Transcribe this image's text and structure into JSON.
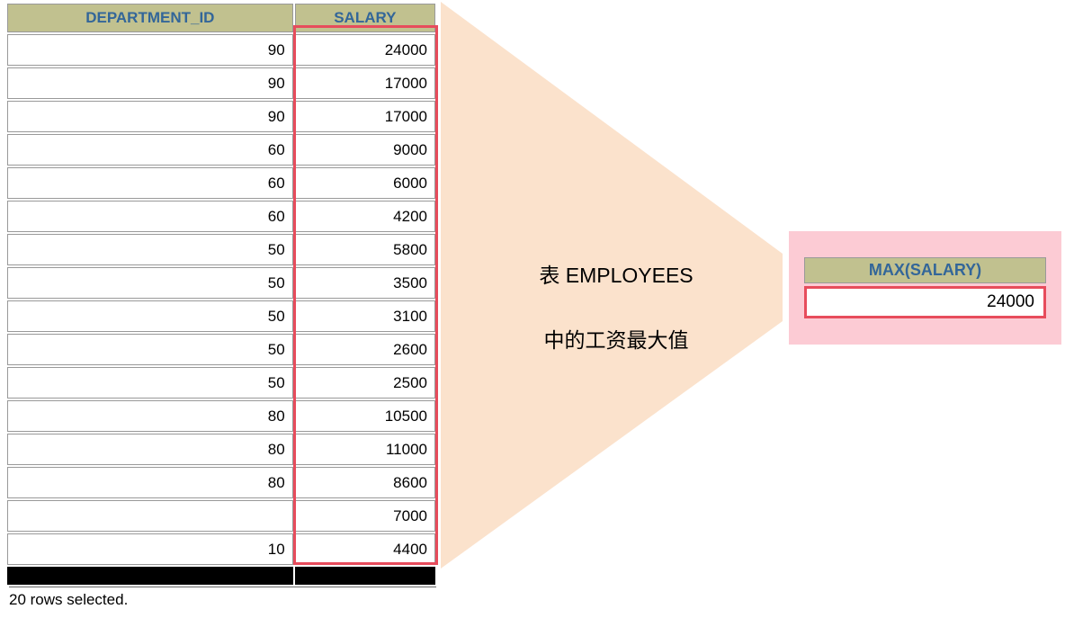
{
  "source_table": {
    "columns": [
      "DEPARTMENT_ID",
      "SALARY"
    ],
    "rows": [
      {
        "dept": "90",
        "salary": "24000"
      },
      {
        "dept": "90",
        "salary": "17000"
      },
      {
        "dept": "90",
        "salary": "17000"
      },
      {
        "dept": "60",
        "salary": "9000"
      },
      {
        "dept": "60",
        "salary": "6000"
      },
      {
        "dept": "60",
        "salary": "4200"
      },
      {
        "dept": "50",
        "salary": "5800"
      },
      {
        "dept": "50",
        "salary": "3500"
      },
      {
        "dept": "50",
        "salary": "3100"
      },
      {
        "dept": "50",
        "salary": "2600"
      },
      {
        "dept": "50",
        "salary": "2500"
      },
      {
        "dept": "80",
        "salary": "10500"
      },
      {
        "dept": "80",
        "salary": "11000"
      },
      {
        "dept": "80",
        "salary": "8600"
      },
      {
        "dept": "",
        "salary": "7000"
      },
      {
        "dept": "10",
        "salary": "4400"
      }
    ]
  },
  "footer": "20 rows selected.",
  "annotation": {
    "line1": "表 EMPLOYEES",
    "line2": "中的工资最大值"
  },
  "result_table": {
    "header": "MAX(SALARY)",
    "value": "24000"
  },
  "chart_data": {
    "type": "table",
    "title": "MAX aggregate over EMPLOYEES.SALARY",
    "source_columns": [
      "DEPARTMENT_ID",
      "SALARY"
    ],
    "source_rows": [
      [
        90,
        24000
      ],
      [
        90,
        17000
      ],
      [
        90,
        17000
      ],
      [
        60,
        9000
      ],
      [
        60,
        6000
      ],
      [
        60,
        4200
      ],
      [
        50,
        5800
      ],
      [
        50,
        3500
      ],
      [
        50,
        3100
      ],
      [
        50,
        2600
      ],
      [
        50,
        2500
      ],
      [
        80,
        10500
      ],
      [
        80,
        11000
      ],
      [
        80,
        8600
      ],
      [
        null,
        7000
      ],
      [
        10,
        4400
      ]
    ],
    "aggregate": {
      "function": "MAX",
      "column": "SALARY",
      "result": 24000
    },
    "rows_selected": 20
  }
}
